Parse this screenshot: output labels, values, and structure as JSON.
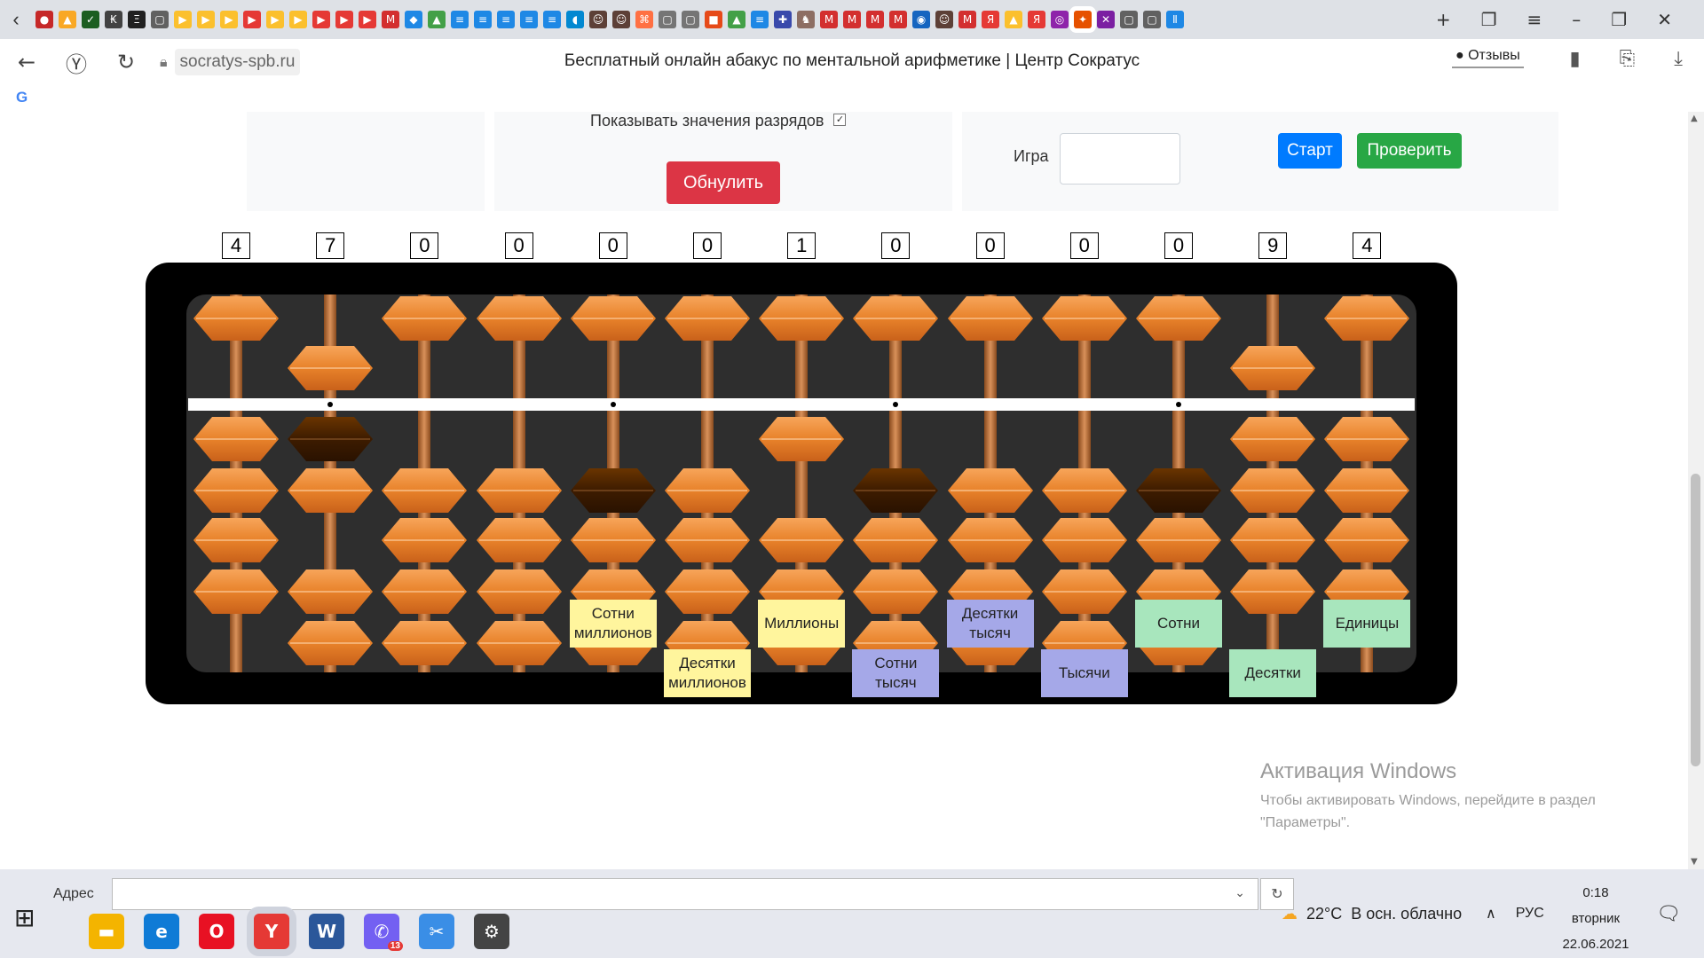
{
  "browser": {
    "tab_icons": [
      {
        "name": "tab-icon-1",
        "color": "#c62828",
        "glyph": "●"
      },
      {
        "name": "tab-icon-2",
        "color": "#f9a825",
        "glyph": "▲"
      },
      {
        "name": "tab-icon-3",
        "color": "#1b5e20",
        "glyph": "✓"
      },
      {
        "name": "tab-icon-4",
        "color": "#424242",
        "glyph": "₭"
      },
      {
        "name": "tab-icon-5",
        "color": "#212121",
        "glyph": "Ξ"
      },
      {
        "name": "tab-icon-6",
        "color": "#616161",
        "glyph": "▢"
      },
      {
        "name": "tab-icon-7",
        "color": "#fbc02d",
        "glyph": "▶"
      },
      {
        "name": "tab-icon-8",
        "color": "#fbc02d",
        "glyph": "▶"
      },
      {
        "name": "tab-icon-9",
        "color": "#fbc02d",
        "glyph": "▶"
      },
      {
        "name": "tab-icon-10",
        "color": "#e53935",
        "glyph": "▶"
      },
      {
        "name": "tab-icon-11",
        "color": "#fbc02d",
        "glyph": "▶"
      },
      {
        "name": "tab-icon-12",
        "color": "#fbc02d",
        "glyph": "▶"
      },
      {
        "name": "tab-icon-13",
        "color": "#e53935",
        "glyph": "▶"
      },
      {
        "name": "tab-icon-14",
        "color": "#e53935",
        "glyph": "▶"
      },
      {
        "name": "tab-icon-15",
        "color": "#e53935",
        "glyph": "▶"
      },
      {
        "name": "tab-icon-16",
        "color": "#d32f2f",
        "glyph": "M"
      },
      {
        "name": "tab-icon-17",
        "color": "#1e88e5",
        "glyph": "◆"
      },
      {
        "name": "tab-icon-18",
        "color": "#43a047",
        "glyph": "▲"
      },
      {
        "name": "tab-icon-19",
        "color": "#1e88e5",
        "glyph": "≡"
      },
      {
        "name": "tab-icon-20",
        "color": "#1e88e5",
        "glyph": "≡"
      },
      {
        "name": "tab-icon-21",
        "color": "#1e88e5",
        "glyph": "≡"
      },
      {
        "name": "tab-icon-22",
        "color": "#1e88e5",
        "glyph": "≡"
      },
      {
        "name": "tab-icon-23",
        "color": "#1e88e5",
        "glyph": "≡"
      },
      {
        "name": "tab-icon-24",
        "color": "#0288d1",
        "glyph": "◖"
      },
      {
        "name": "tab-icon-25",
        "color": "#5d4037",
        "glyph": "☺"
      },
      {
        "name": "tab-icon-26",
        "color": "#5d4037",
        "glyph": "☺"
      },
      {
        "name": "tab-icon-27",
        "color": "#ff7043",
        "glyph": "⌘"
      },
      {
        "name": "tab-icon-28",
        "color": "#757575",
        "glyph": "▢"
      },
      {
        "name": "tab-icon-29",
        "color": "#757575",
        "glyph": "▢"
      },
      {
        "name": "tab-icon-30",
        "color": "#e64a19",
        "glyph": "■"
      },
      {
        "name": "tab-icon-31",
        "color": "#43a047",
        "glyph": "▲"
      },
      {
        "name": "tab-icon-32",
        "color": "#1e88e5",
        "glyph": "≡"
      },
      {
        "name": "tab-icon-33",
        "color": "#3949ab",
        "glyph": "✚"
      },
      {
        "name": "tab-icon-34",
        "color": "#8d6e63",
        "glyph": "♞"
      },
      {
        "name": "tab-icon-35",
        "color": "#d32f2f",
        "glyph": "M"
      },
      {
        "name": "tab-icon-36",
        "color": "#d32f2f",
        "glyph": "M"
      },
      {
        "name": "tab-icon-37",
        "color": "#d32f2f",
        "glyph": "M"
      },
      {
        "name": "tab-icon-38",
        "color": "#d32f2f",
        "glyph": "M"
      },
      {
        "name": "tab-icon-39",
        "color": "#1565c0",
        "glyph": "◉"
      },
      {
        "name": "tab-icon-40",
        "color": "#5d4037",
        "glyph": "☺"
      },
      {
        "name": "tab-icon-41",
        "color": "#d32f2f",
        "glyph": "M"
      },
      {
        "name": "tab-icon-42",
        "color": "#e53935",
        "glyph": "Я"
      },
      {
        "name": "tab-icon-43",
        "color": "#fbc02d",
        "glyph": "▲"
      },
      {
        "name": "tab-icon-44",
        "color": "#e53935",
        "glyph": "Я"
      },
      {
        "name": "tab-icon-45",
        "color": "#8e24aa",
        "glyph": "◎"
      },
      {
        "name": "tab-icon-46",
        "color": "#e65100",
        "glyph": "✦"
      },
      {
        "name": "tab-icon-47",
        "color": "#7b1fa2",
        "glyph": "✕"
      },
      {
        "name": "tab-icon-48",
        "color": "#616161",
        "glyph": "▢"
      },
      {
        "name": "tab-icon-49",
        "color": "#616161",
        "glyph": "▢"
      },
      {
        "name": "tab-icon-50",
        "color": "#1e88e5",
        "glyph": "Ⅱ"
      }
    ],
    "new_tab": "+",
    "domain": "socratys-spb.ru",
    "title": "Бесплатный онлайн абакус по ментальной арифметике | Центр Сократус",
    "reviews": "Отзывы",
    "g_letter": "G"
  },
  "controls": {
    "show_digits_label": "Показывать значения разрядов",
    "show_digits_checked": true,
    "reset_label": "Обнулить",
    "game_label": "Игра",
    "game_value": "",
    "start_label": "Старт",
    "check_label": "Проверить"
  },
  "abacus": {
    "digits": [
      "4",
      "7",
      "0",
      "0",
      "0",
      "0",
      "1",
      "0",
      "0",
      "0",
      "0",
      "9",
      "4"
    ],
    "highlighted_beads": [
      {
        "rod": 1,
        "position": "lower-1"
      },
      {
        "rod": 4,
        "position": "lower-2"
      },
      {
        "rod": 7,
        "position": "lower-2"
      },
      {
        "rod": 10,
        "position": "lower-2"
      }
    ],
    "bead_color": "#e8822a",
    "highlight_color": "#4a2000",
    "frame_color": "#000000"
  },
  "place_labels": [
    {
      "rod": 4,
      "text": "Сотни миллионов",
      "color": "yellow",
      "row": 0
    },
    {
      "rod": 5,
      "text": "Десятки миллионов",
      "color": "yellow",
      "row": 1
    },
    {
      "rod": 6,
      "text": "Миллионы",
      "color": "yellow",
      "row": 0
    },
    {
      "rod": 7,
      "text": "Сотни тысяч",
      "color": "blue",
      "row": 1
    },
    {
      "rod": 8,
      "text": "Десятки тысяч",
      "color": "blue",
      "row": 0
    },
    {
      "rod": 9,
      "text": "Тысячи",
      "color": "blue",
      "row": 1
    },
    {
      "rod": 10,
      "text": "Сотни",
      "color": "green",
      "row": 0
    },
    {
      "rod": 11,
      "text": "Десятки",
      "color": "green",
      "row": 1
    },
    {
      "rod": 12,
      "text": "Единицы",
      "color": "green",
      "row": 0
    }
  ],
  "activation": {
    "title": "Активация Windows",
    "subtitle": "Чтобы активировать Windows, перейдите в раздел \"Параметры\"."
  },
  "taskbar": {
    "address_label": "Адрес",
    "address_value": "",
    "apps": [
      {
        "name": "file-explorer",
        "glyph": "▬",
        "color": "#f4b400"
      },
      {
        "name": "edge",
        "glyph": "e",
        "color": "#0f7bd6"
      },
      {
        "name": "opera",
        "glyph": "O",
        "color": "#e81123"
      },
      {
        "name": "yandex-browser",
        "glyph": "Y",
        "color": "#e53935",
        "active": true
      },
      {
        "name": "word",
        "glyph": "W",
        "color": "#2b579a"
      },
      {
        "name": "viber",
        "glyph": "✆",
        "color": "#7360f2",
        "badge": "13"
      },
      {
        "name": "snipping-tool",
        "glyph": "✂",
        "color": "#3a8ee6"
      },
      {
        "name": "settings",
        "glyph": "⚙",
        "color": "#444444"
      }
    ],
    "weather_temp": "22°C",
    "weather_text": "В осн. облачно",
    "lang": "РУС",
    "time": "0:18",
    "weekday": "вторник",
    "date": "22.06.2021"
  }
}
